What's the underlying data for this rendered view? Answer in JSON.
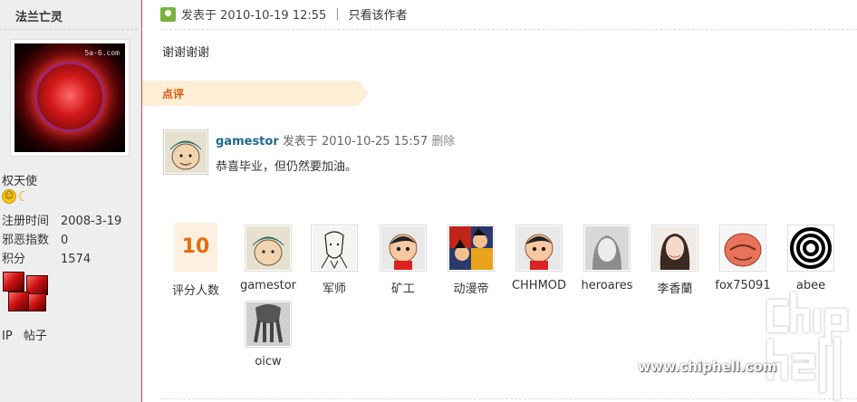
{
  "sidebar": {
    "username": "法兰亡灵",
    "rank": "权天使",
    "stats": [
      {
        "label": "注册时间",
        "value": "2008-3-19"
      },
      {
        "label": "邪恶指数",
        "value": "0"
      },
      {
        "label": "积分",
        "value": "1574"
      }
    ],
    "links": {
      "ip": "IP",
      "posts": "帖子"
    }
  },
  "post": {
    "meta_prefix": "发表于 2010-10-19 12:55",
    "divider": "|",
    "only_author": "只看该作者",
    "body": "谢谢谢谢"
  },
  "comments_section": {
    "tab_label": "点评",
    "comment": {
      "user": "gamestor",
      "meta": "发表于 2010-10-25 15:57",
      "delete": "删除",
      "text": "恭喜毕业，但仍然要加油。"
    }
  },
  "rating": {
    "count": "10",
    "label": "评分人数",
    "raters": [
      "gamestor",
      "军师",
      "矿工",
      "动漫帝",
      "CHHMOD",
      "heroares",
      "李香蘭",
      "fox75091",
      "abee",
      "oicw"
    ]
  },
  "watermark": {
    "url": "www.chiphell.com"
  },
  "colors": {
    "accent": "#e56b0f",
    "link": "#1c6b8f",
    "sidebar_bg": "#eeeeee",
    "online": "#7ab241"
  }
}
